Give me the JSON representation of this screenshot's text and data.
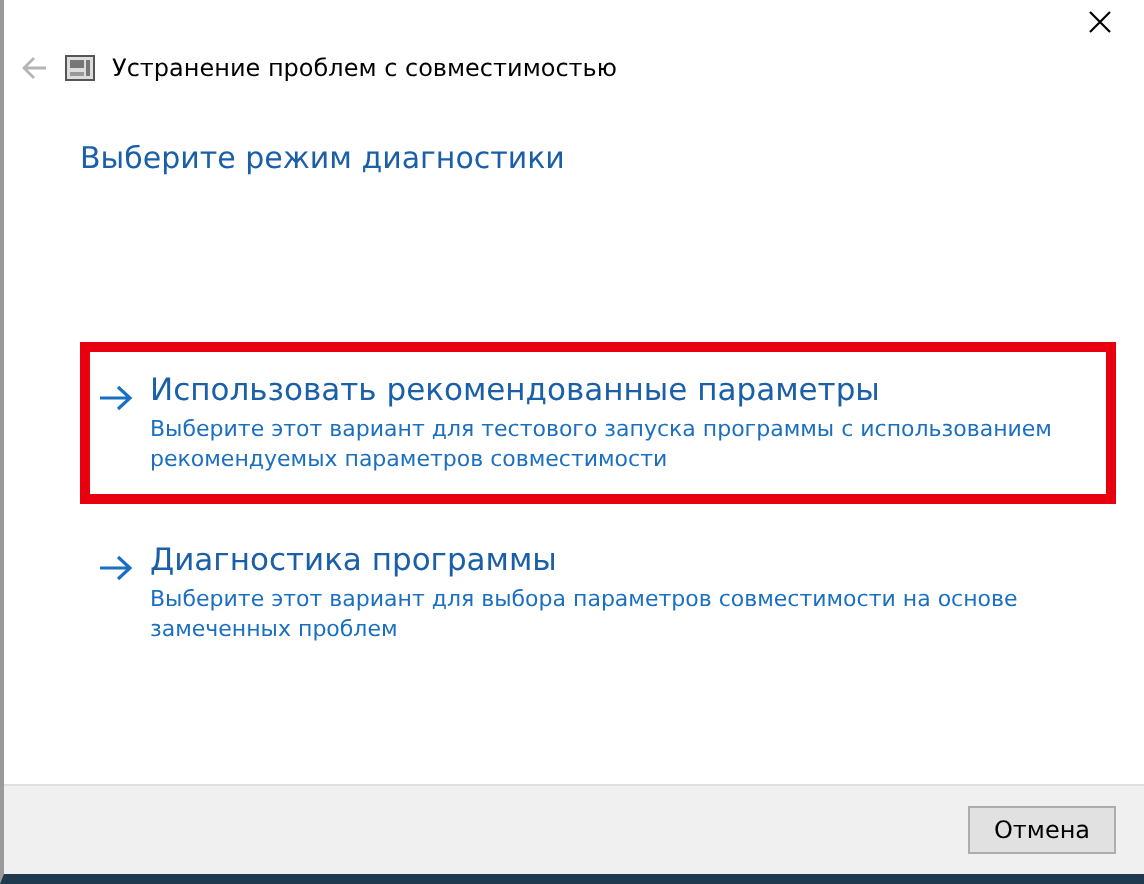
{
  "window": {
    "title": "Устранение проблем с совместимостью"
  },
  "heading": "Выберите режим диагностики",
  "options": [
    {
      "title": "Использовать рекомендованные параметры",
      "description": "Выберите этот вариант для тестового запуска программы с использованием рекомендуемых параметров совместимости",
      "highlighted": true
    },
    {
      "title": "Диагностика программы",
      "description": "Выберите этот вариант для выбора параметров совместимости на основе замеченных проблем",
      "highlighted": false
    }
  ],
  "buttons": [
    "Отмена"
  ]
}
